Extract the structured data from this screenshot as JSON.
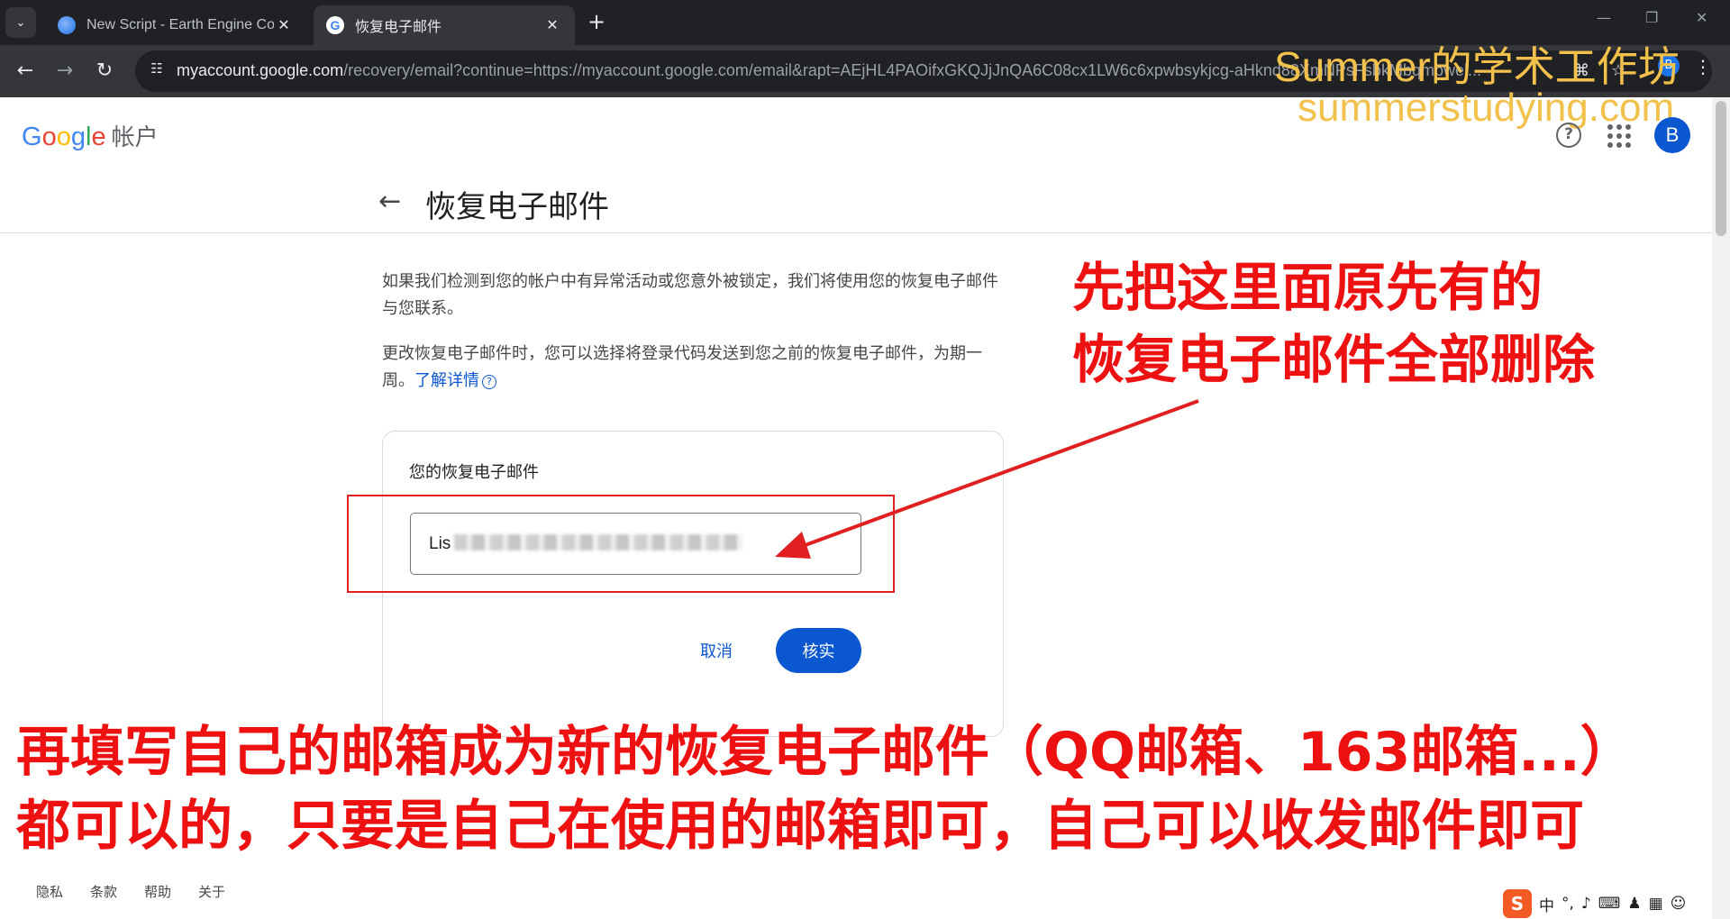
{
  "browser": {
    "tabs": [
      {
        "title": "New Script - Earth Engine Co",
        "active": false
      },
      {
        "title": "恢复电子邮件",
        "active": true
      }
    ],
    "url_host": "myaccount.google.com",
    "url_rest": "/recovery/email?continue=https://myaccount.google.com/email&rapt=AEjHL4PAOifxGKQJjJnQA6C08cx1LW6c6xpwbsykjcg-aHknd88XmNPsFsbkMbqmbwel...",
    "profile_initial": "B"
  },
  "watermark": {
    "line1": "Summer的学术工作坊",
    "line2": "summerstudying.com"
  },
  "header": {
    "logo_letters": [
      "G",
      "o",
      "o",
      "g",
      "l",
      "e"
    ],
    "product": "帐户",
    "avatar_initial": "B"
  },
  "page": {
    "title": "恢复电子邮件",
    "para1": "如果我们检测到您的帐户中有异常活动或您意外被锁定，我们将使用您的恢复电子邮件与您联系。",
    "para2": "更改恢复电子邮件时，您可以选择将登录代码发送到您之前的恢复电子邮件，为期一周。",
    "learn_more": "了解详情",
    "card_label": "您的恢复电子邮件",
    "email_value": "Lis",
    "cancel": "取消",
    "verify": "核实"
  },
  "footer": {
    "links": [
      "隐私",
      "条款",
      "帮助",
      "关于"
    ]
  },
  "annotations": {
    "right_line1": "先把这里面原先有的",
    "right_line2": "恢复电子邮件全部删除",
    "bottom_line1": "再填写自己的邮箱成为新的恢复电子邮件（QQ邮箱、163邮箱...）",
    "bottom_line2": "都可以的，只要是自己在使用的邮箱即可，自己可以收发邮件即可"
  },
  "ime": {
    "logo": "S",
    "mode": "中"
  }
}
